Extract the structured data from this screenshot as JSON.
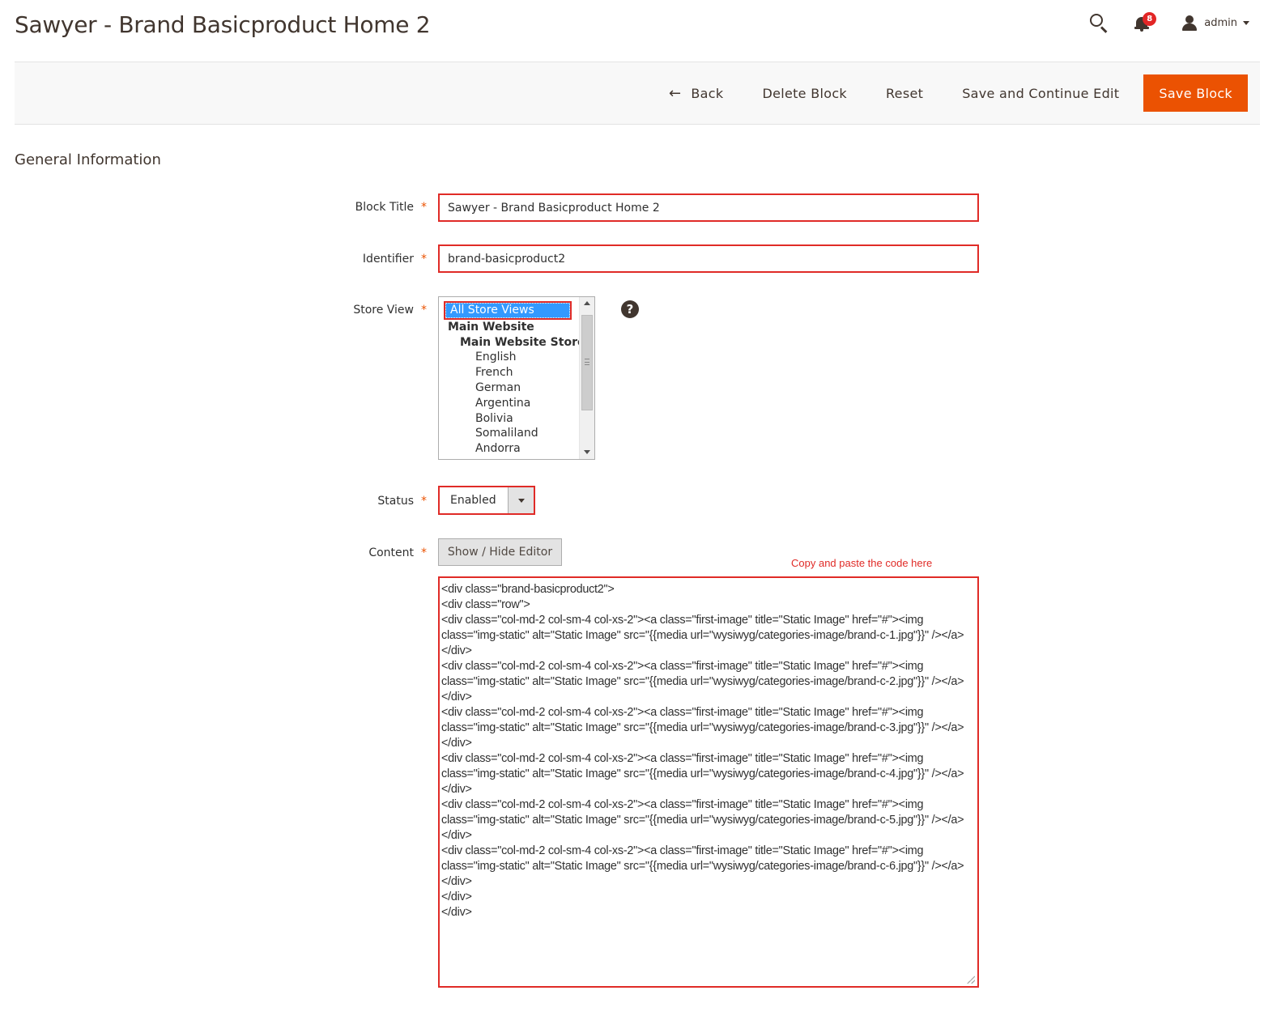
{
  "page": {
    "title": "Sawyer - Brand Basicproduct Home 2"
  },
  "header": {
    "notifications_count": "8",
    "user_name": "admin"
  },
  "toolbar": {
    "back_label": "Back",
    "back_arrow": "←",
    "delete_label": "Delete Block",
    "reset_label": "Reset",
    "save_continue_label": "Save and Continue Edit",
    "save_label": "Save Block"
  },
  "section": {
    "title": "General Information"
  },
  "form": {
    "block_title": {
      "label": "Block Title",
      "value": "Sawyer - Brand Basicproduct Home 2"
    },
    "identifier": {
      "label": "Identifier",
      "value": "brand-basicproduct2"
    },
    "store_view": {
      "label": "Store View",
      "options": [
        {
          "label": "All Store Views",
          "level": 0,
          "group": false,
          "selected": true
        },
        {
          "label": "Main Website",
          "level": 1,
          "group": true,
          "selected": false
        },
        {
          "label": "Main Website Store",
          "level": 2,
          "group": true,
          "selected": false
        },
        {
          "label": "English",
          "level": 3,
          "group": false,
          "selected": false
        },
        {
          "label": "French",
          "level": 3,
          "group": false,
          "selected": false
        },
        {
          "label": "German",
          "level": 3,
          "group": false,
          "selected": false
        },
        {
          "label": "Argentina",
          "level": 3,
          "group": false,
          "selected": false
        },
        {
          "label": "Bolivia",
          "level": 3,
          "group": false,
          "selected": false
        },
        {
          "label": "Somaliland",
          "level": 3,
          "group": false,
          "selected": false
        },
        {
          "label": "Andorra",
          "level": 3,
          "group": false,
          "selected": false
        }
      ],
      "help": "?"
    },
    "status": {
      "label": "Status",
      "value": "Enabled"
    },
    "content": {
      "label": "Content",
      "editor_button": "Show / Hide Editor",
      "annotation": "Copy and paste the code here",
      "code": "<div class=\"brand-basicproduct2\">\n<div class=\"row\">\n<div class=\"col-md-2 col-sm-4 col-xs-2\"><a class=\"first-image\" title=\"Static Image\" href=\"#\"><img class=\"img-static\" alt=\"Static Image\" src=\"{{media url=\"wysiwyg/categories-image/brand-c-1.jpg\"}}\" /></a></div>\n<div class=\"col-md-2 col-sm-4 col-xs-2\"><a class=\"first-image\" title=\"Static Image\" href=\"#\"><img class=\"img-static\" alt=\"Static Image\" src=\"{{media url=\"wysiwyg/categories-image/brand-c-2.jpg\"}}\" /></a></div>\n<div class=\"col-md-2 col-sm-4 col-xs-2\"><a class=\"first-image\" title=\"Static Image\" href=\"#\"><img class=\"img-static\" alt=\"Static Image\" src=\"{{media url=\"wysiwyg/categories-image/brand-c-3.jpg\"}}\" /></a></div>\n<div class=\"col-md-2 col-sm-4 col-xs-2\"><a class=\"first-image\" title=\"Static Image\" href=\"#\"><img class=\"img-static\" alt=\"Static Image\" src=\"{{media url=\"wysiwyg/categories-image/brand-c-4.jpg\"}}\" /></a></div>\n<div class=\"col-md-2 col-sm-4 col-xs-2\"><a class=\"first-image\" title=\"Static Image\" href=\"#\"><img class=\"img-static\" alt=\"Static Image\" src=\"{{media url=\"wysiwyg/categories-image/brand-c-5.jpg\"}}\" /></a></div>\n<div class=\"col-md-2 col-sm-4 col-xs-2\"><a class=\"first-image\" title=\"Static Image\" href=\"#\"><img class=\"img-static\" alt=\"Static Image\" src=\"{{media url=\"wysiwyg/categories-image/brand-c-6.jpg\"}}\" /></a></div>\n</div>\n</div>"
    },
    "required_mark": "*"
  },
  "colors": {
    "accent": "#eb5202",
    "highlight_border": "#e02b27",
    "selection": "#3399ff",
    "text": "#41362f"
  },
  "icons": {
    "search": "search-icon",
    "notifications": "bell-icon",
    "user": "user-icon",
    "help": "help-icon",
    "back": "arrow-left-icon"
  }
}
